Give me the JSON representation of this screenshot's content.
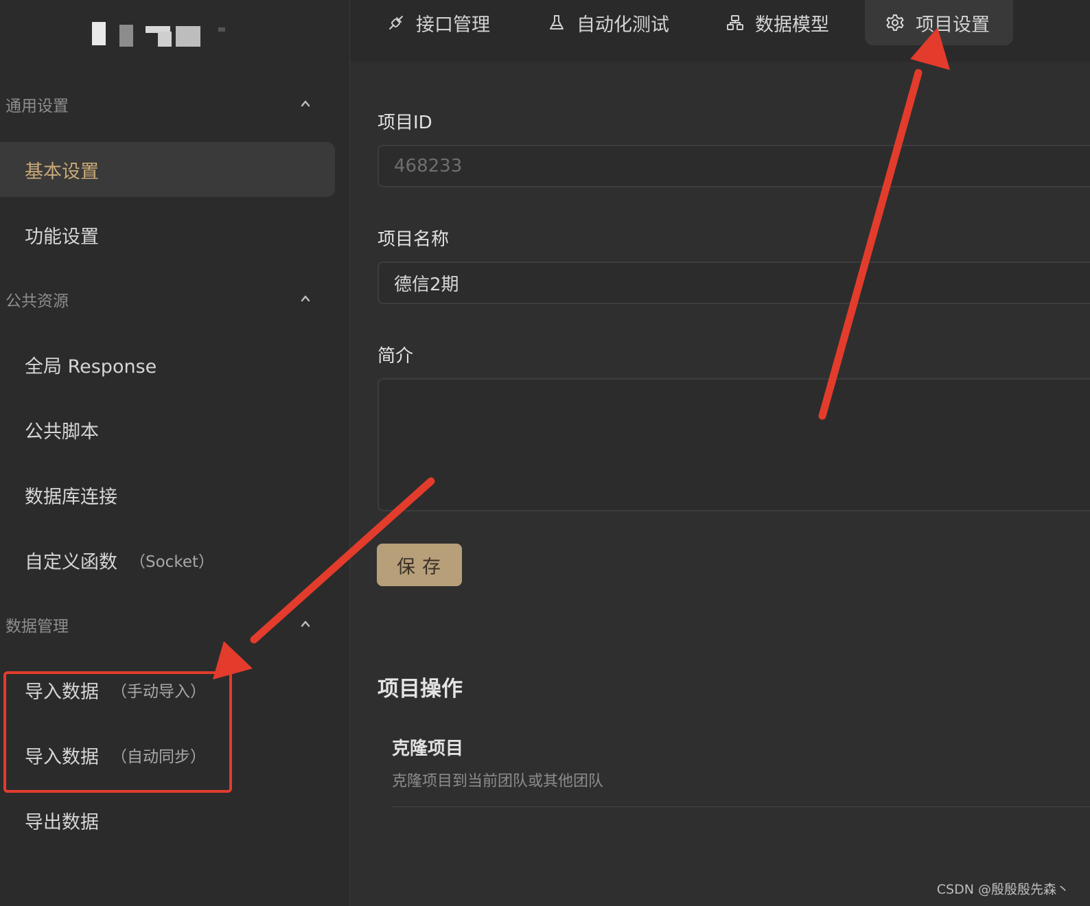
{
  "sidebar": {
    "groups": [
      {
        "title": "通用设置",
        "items": [
          {
            "label": "基本设置",
            "sub": ""
          },
          {
            "label": "功能设置",
            "sub": ""
          }
        ]
      },
      {
        "title": "公共资源",
        "items": [
          {
            "label": "全局 Response",
            "sub": ""
          },
          {
            "label": "公共脚本",
            "sub": ""
          },
          {
            "label": "数据库连接",
            "sub": ""
          },
          {
            "label": "自定义函数",
            "sub": "（Socket）"
          }
        ]
      },
      {
        "title": "数据管理",
        "items": [
          {
            "label": "导入数据",
            "sub": "（手动导入）"
          },
          {
            "label": "导入数据",
            "sub": "（自动同步）"
          },
          {
            "label": "导出数据",
            "sub": ""
          }
        ]
      }
    ],
    "active_item": "基本设置"
  },
  "tabs": [
    {
      "label": "接口管理",
      "icon": "link-icon"
    },
    {
      "label": "自动化测试",
      "icon": "flask-icon"
    },
    {
      "label": "数据模型",
      "icon": "data-model-icon"
    },
    {
      "label": "项目设置",
      "icon": "gear-icon"
    }
  ],
  "active_tab": "项目设置",
  "form": {
    "project_id_label": "项目ID",
    "project_id_value": "468233",
    "project_name_label": "项目名称",
    "project_name_value": "德信2期",
    "intro_label": "简介",
    "intro_value": "",
    "save_label": "保存"
  },
  "operations": {
    "section_title": "项目操作",
    "clone_title": "克隆项目",
    "clone_desc": "克隆项目到当前团队或其他团队"
  },
  "watermark": "CSDN @殷殷殷先森丶",
  "colors": {
    "accent": "#c9a977",
    "save_button": "#b79f7a",
    "annotation_red": "#e33c2c",
    "background": "#2f2f2f",
    "sidebar_bg": "#2b2b2b"
  }
}
